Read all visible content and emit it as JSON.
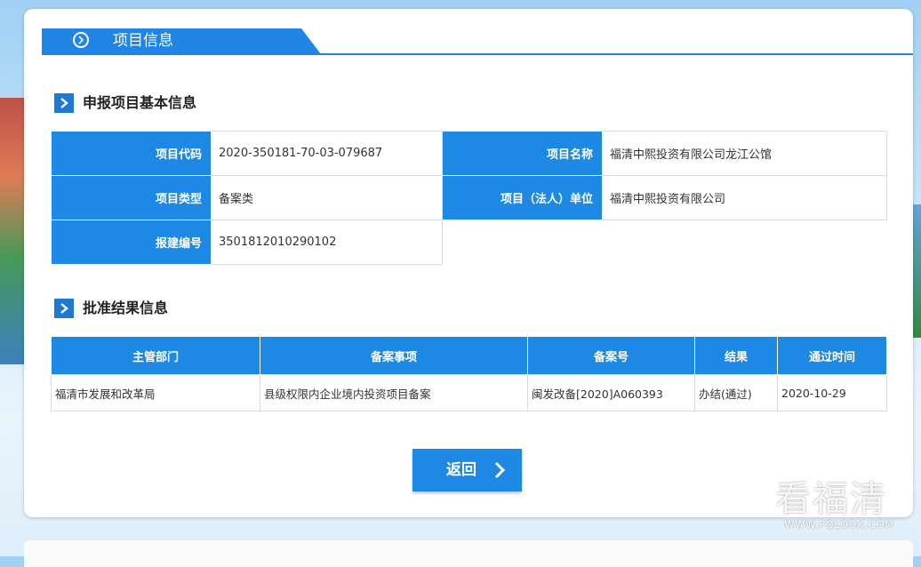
{
  "panel_title": "项目信息",
  "basic_section": {
    "title": "申报项目基本信息",
    "rows": [
      {
        "l1": "项目代码",
        "v1": "2020-350181-70-03-079687",
        "l2": "项目名称",
        "v2": "福清中熙投资有限公司龙江公馆"
      },
      {
        "l1": "项目类型",
        "v1": "备案类",
        "l2": "项目（法人）单位",
        "v2": "福清中熙投资有限公司"
      },
      {
        "l1": "报建编号",
        "v1": "3501812010290102"
      }
    ]
  },
  "result_section": {
    "title": "批准结果信息",
    "headers": [
      "主管部门",
      "备案事项",
      "备案号",
      "结果",
      "通过时间"
    ],
    "rows": [
      [
        "福清市发展和改革局",
        "县级权限内企业境内投资项目备案",
        "闽发改备[2020]A060393",
        "办结(通过)",
        "2020-10-29"
      ]
    ]
  },
  "back_button": "返回",
  "watermark": {
    "main": "看福清",
    "sub": "WWW.FQLOOK.COM"
  },
  "colors": {
    "accent": "#1e88e5",
    "section_icon": "#1f78d1"
  }
}
